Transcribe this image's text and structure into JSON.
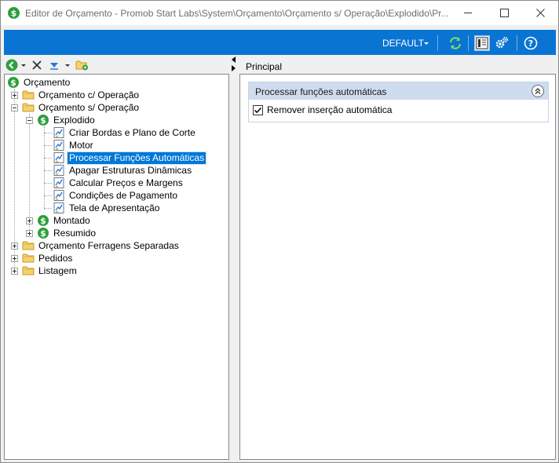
{
  "window": {
    "title": "Editor de Orçamento - Promob Start Labs\\System\\Orçamento\\Orçamento s/ Operação\\Explodido\\Pr..."
  },
  "toolbar": {
    "profile_label": "DEFAULT"
  },
  "tree": {
    "root": "Orçamento",
    "items": [
      {
        "label": "Orçamento c/ Operação"
      },
      {
        "label": "Orçamento s/ Operação"
      },
      {
        "label": "Explodido"
      },
      {
        "label": "Criar Bordas e Plano de Corte"
      },
      {
        "label": "Motor"
      },
      {
        "label": "Processar Funções Automáticas"
      },
      {
        "label": "Apagar Estruturas Dinâmicas"
      },
      {
        "label": "Calcular Preços e Margens"
      },
      {
        "label": "Condições de Pagamento"
      },
      {
        "label": "Tela de Apresentação"
      },
      {
        "label": "Montado"
      },
      {
        "label": "Resumido"
      },
      {
        "label": "Orçamento Ferragens Separadas"
      },
      {
        "label": "Pedidos"
      },
      {
        "label": "Listagem"
      }
    ]
  },
  "right": {
    "header": "Principal",
    "group_title": "Processar funções automáticas",
    "checkbox_label": "Remover inserção automática"
  },
  "colors": {
    "toolbar_blue": "#0a74d3",
    "selection": "#0078d7",
    "group_header": "#cfdcee",
    "money_green": "#2e9e3e",
    "folder_yellow": "#f3d26b"
  }
}
